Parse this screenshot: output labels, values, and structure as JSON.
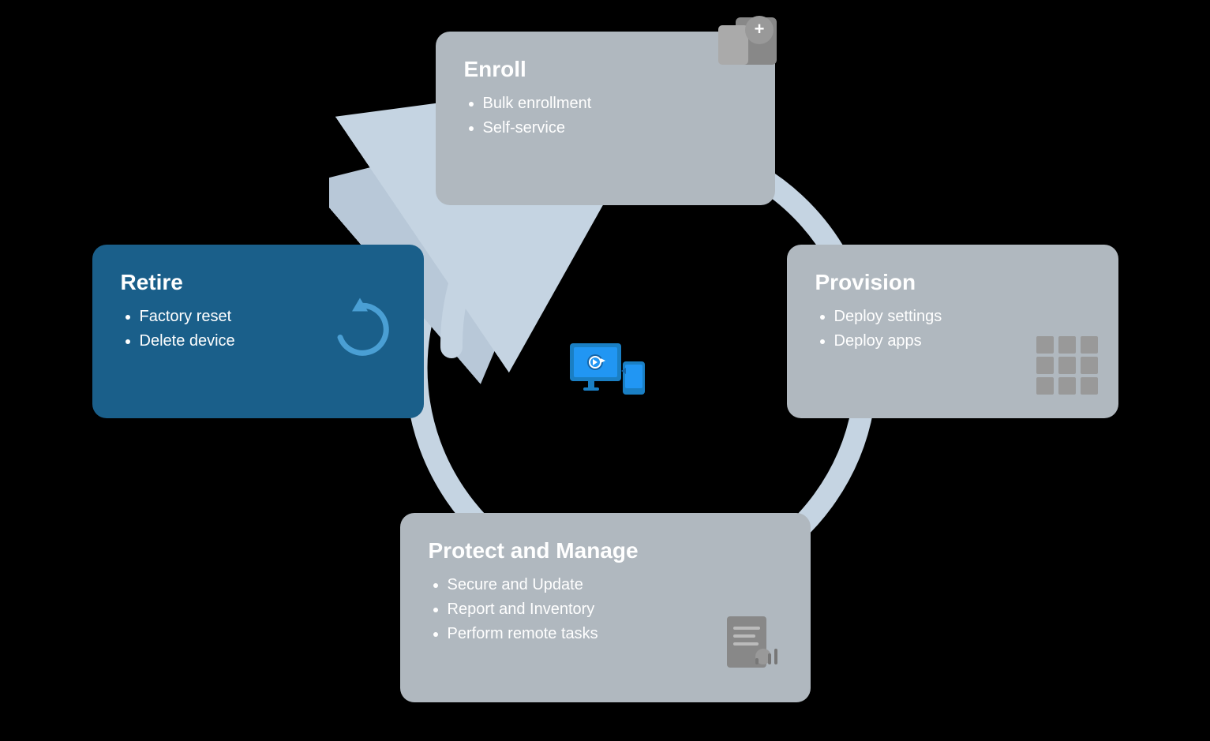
{
  "cards": {
    "enroll": {
      "title": "Enroll",
      "items": [
        "Bulk enrollment",
        "Self-service"
      ]
    },
    "provision": {
      "title": "Provision",
      "items": [
        "Deploy settings",
        "Deploy apps"
      ]
    },
    "protect": {
      "title": "Protect and Manage",
      "items": [
        "Secure and Update",
        "Report and Inventory",
        "Perform remote tasks"
      ]
    },
    "retire": {
      "title": "Retire",
      "items": [
        "Factory reset",
        "Delete device"
      ]
    }
  },
  "colors": {
    "card_gray": "#b3bcc2",
    "card_blue": "#1a5f8a",
    "arrow_color": "#c8d4e0",
    "icon_blue": "#2a7fc9"
  }
}
